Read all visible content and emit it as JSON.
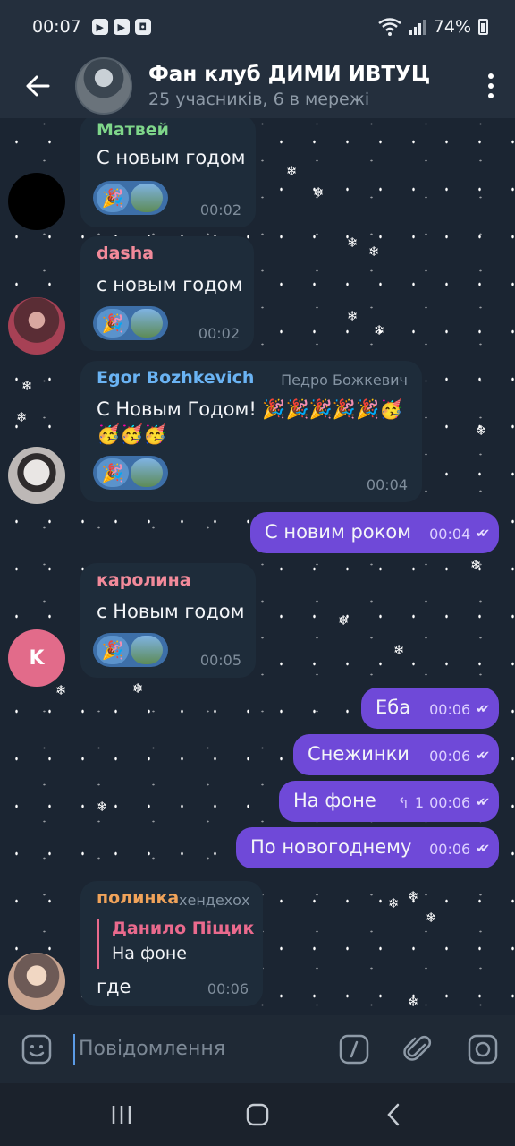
{
  "status": {
    "time": "00:07",
    "battery": "74%"
  },
  "header": {
    "title": "Фан клуб ДИМИ ИВТУЦ",
    "subtitle": "25 учасників, 6 в мережі"
  },
  "messages": [
    {
      "sender": "Матвей",
      "text": "С новым годом",
      "time": "00:02",
      "name_color": "#7fd68a"
    },
    {
      "sender": "dasha",
      "text": "с новым годом",
      "time": "00:02",
      "name_color": "#f28a9a"
    },
    {
      "sender": "Egor Bozhkevich",
      "role": "Педро Божкевич",
      "text_line1": "С Новым Годом! 🎉🎉🎉🎉🎉🥳",
      "text_line2": "🥳🥳🥳",
      "time": "00:04",
      "name_color": "#6ab3f3"
    },
    {
      "text": "С новим роком",
      "time": "00:04"
    },
    {
      "sender": "каролина",
      "text": "с Новым годом",
      "time": "00:05",
      "name_color": "#f28a9a",
      "avatar_letter": "K"
    },
    {
      "text": "Еба",
      "time": "00:06"
    },
    {
      "text": "Снежинки",
      "time": "00:06"
    },
    {
      "text": "На фоне",
      "time": "00:06",
      "replies": "1"
    },
    {
      "text": "По новогоднему",
      "time": "00:06"
    },
    {
      "sender": "полинка",
      "role": "хендехох",
      "reply_to_name": "Данило Піщик",
      "reply_to_text": "На фоне",
      "text": "где",
      "time": "00:06",
      "name_color": "#f0a35a"
    }
  ],
  "composer": {
    "placeholder": "Повідомлення"
  },
  "icons": {
    "back": "arrow-left-icon",
    "menu": "more-vert-icon",
    "emoji": "emoji-icon",
    "commands": "slash-command-icon",
    "attach": "paperclip-icon",
    "camera": "camera-icon"
  },
  "colors": {
    "accent": "#6f49d8",
    "header_bg": "#242f3d",
    "chat_bg": "#1b2532"
  }
}
